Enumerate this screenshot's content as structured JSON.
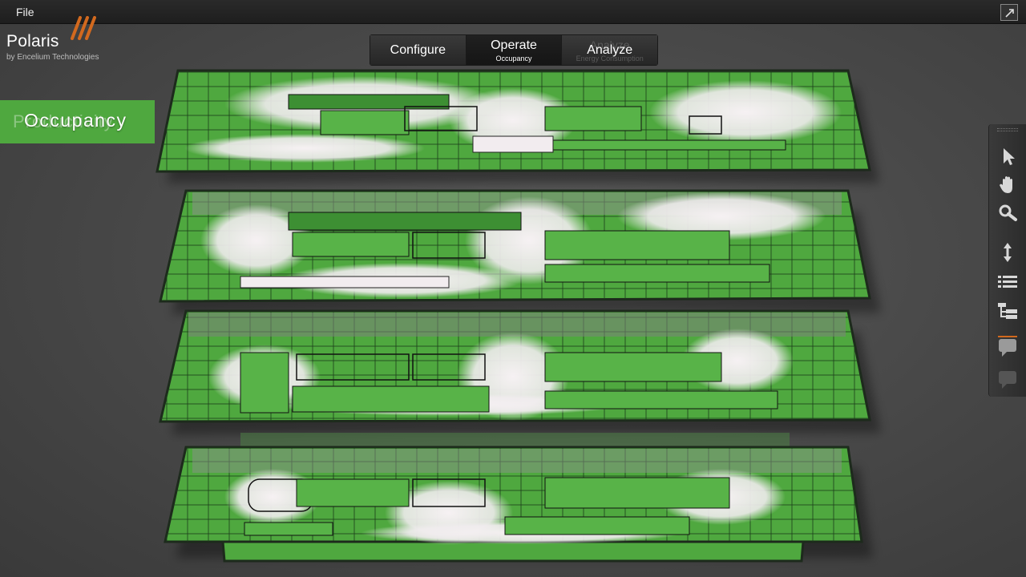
{
  "menubar": {
    "file_label": "File"
  },
  "brand": {
    "name": "Polaris",
    "subtitle": "by Encelium Technologies"
  },
  "modes": [
    {
      "label": "Configure"
    },
    {
      "label": "Operate",
      "sub": "Occupancy"
    },
    {
      "label": "Analyze",
      "ghost": "Analyze",
      "ghost_sub": "Energy Consumption"
    }
  ],
  "overlay": {
    "title": "Occupancy",
    "ghost_title": "Productivity"
  },
  "colors": {
    "occupied": "#4fa83f",
    "occupied_dark": "#2f7a2a",
    "unoccupied": "#f2ecef",
    "floor_edge": "#1d2a1c",
    "accent": "#d2691e"
  },
  "toolbar": {
    "tools": [
      "select-arrow-icon",
      "pan-hand-icon",
      "zoom-magnifier-icon",
      "vertical-spread-icon",
      "list-view-icon",
      "tree-view-icon",
      "comment-icon",
      "chat-icon"
    ]
  }
}
